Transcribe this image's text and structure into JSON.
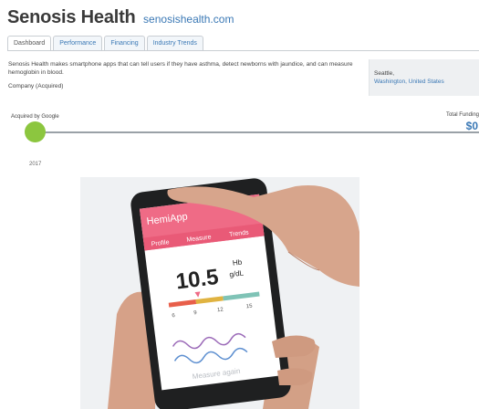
{
  "header": {
    "company_name": "Senosis Health",
    "website": "senosishealth.com"
  },
  "tabs": [
    {
      "label": "Dashboard",
      "active": true
    },
    {
      "label": "Performance",
      "active": false
    },
    {
      "label": "Financing",
      "active": false
    },
    {
      "label": "Industry Trends",
      "active": false
    }
  ],
  "overview": {
    "description": "Senosis Health makes smartphone apps that can tell users if they have asthma, detect newborns with jaundice, and can measure hemoglobin in blood.",
    "status": "Company (Acquired)"
  },
  "location": {
    "city": "Seattle,",
    "region": "Washington, United States"
  },
  "timeline": {
    "event_label": "Acquired by Google",
    "year": "2017"
  },
  "funding": {
    "label": "Total Funding",
    "value": "$0"
  },
  "photo": {
    "app_title": "HemiApp",
    "nav_tabs": [
      "Profile",
      "Measure",
      "Trends"
    ],
    "reading_value": "10.5",
    "reading_unit_top": "Hb",
    "reading_unit_bottom": "g/dL",
    "scale_ticks": [
      "6",
      "9",
      "12",
      "15"
    ],
    "footer_text": "Measure again"
  },
  "colors": {
    "link": "#3a78b5",
    "timeline_dot": "#8cc63f",
    "app_header": "#ef6b86"
  }
}
